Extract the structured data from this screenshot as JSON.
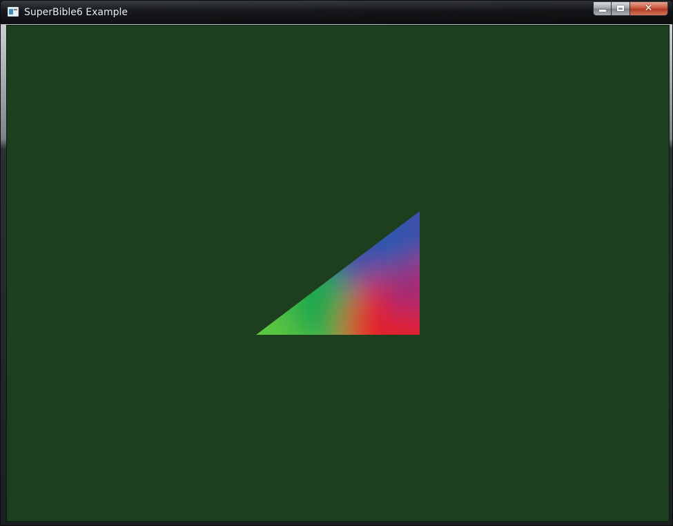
{
  "window": {
    "title": "SuperBible6 Example",
    "icon": "app-window-icon",
    "controls": {
      "minimize_icon": "minimize-icon",
      "maximize_icon": "maximize-icon",
      "close_icon": "close-icon",
      "close_glyph": "✕"
    }
  },
  "scene": {
    "clear_color": "#1d3f20",
    "triangle_vertex_colors": {
      "bottom_left": "#5bc63f",
      "bottom_right": "#e3202b",
      "top_right": "#3f4fa8"
    }
  }
}
